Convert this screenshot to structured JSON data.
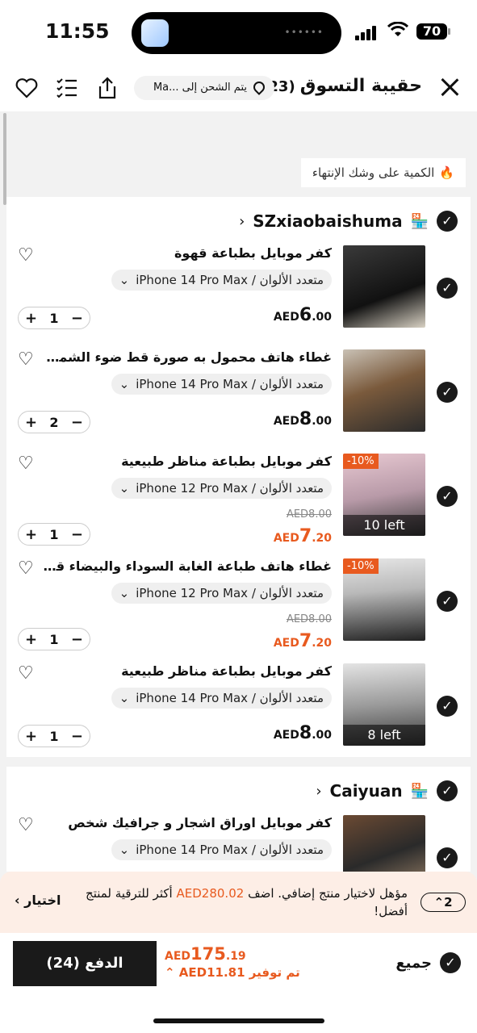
{
  "status_bar": {
    "time": "11:55",
    "battery": "70"
  },
  "header": {
    "title": "حقيبة التسوق",
    "count": "(23)",
    "ship_to": "يتم الشحن إلى ...Ma"
  },
  "notice": "الكمية على وشك الإنتهاء",
  "stores": [
    {
      "name": "SZxiaobaishuma",
      "items": [
        {
          "name": "كفر موبايل بطباعة قهوة",
          "variant": "متعدد الألوان / iPhone 14 Pro Max",
          "qty": "1",
          "currency": "AED",
          "price_int": "6",
          "price_dec": ".00"
        },
        {
          "name": "غطاء هاتف محمول به صورة قط ضوء الشمس وزه...",
          "variant": "متعدد الألوان / iPhone 14 Pro Max",
          "qty": "2",
          "currency": "AED",
          "price_int": "8",
          "price_dec": ".00"
        },
        {
          "name": "كفر موبايل بطباعة مناظر طبيعية",
          "variant": "متعدد الألوان / iPhone 12 Pro Max",
          "qty": "1",
          "currency": "AED",
          "price_int": "7",
          "price_dec": ".20",
          "old_price": "AED8.00",
          "discount": "-10%",
          "stock": "10 left"
        },
        {
          "name": "غطاء هاتف طباعة الغابة السوداء والبيضاء قطعة وا...",
          "variant": "متعدد الألوان / iPhone 12 Pro Max",
          "qty": "1",
          "currency": "AED",
          "price_int": "7",
          "price_dec": ".20",
          "old_price": "AED8.00",
          "discount": "-10%"
        },
        {
          "name": "كفر موبايل بطباعة مناظر طبيعية",
          "variant": "متعدد الألوان / iPhone 14 Pro Max",
          "qty": "1",
          "currency": "AED",
          "price_int": "8",
          "price_dec": ".00",
          "stock": "8 left"
        }
      ]
    },
    {
      "name": "Caiyuan",
      "items": [
        {
          "name": "كفر موبايل اوراق اشجار و جرافيك شخص",
          "variant": "متعدد الألوان / iPhone 14 Pro Max"
        }
      ]
    }
  ],
  "upsell": {
    "badge": "2",
    "text_before": "مؤهل لاختيار منتج إضافي. اضف",
    "amount": "AED280.02",
    "text_after": "أكثر للترقية لمنتج أفضل!",
    "action": "اختيار"
  },
  "bottom": {
    "select_all": "جميع",
    "total_currency": "AED",
    "total_int": "175",
    "total_dec": ".19",
    "saving_label": "تم توفير",
    "saving_amount": "AED11.81",
    "pay_label": "الدفع",
    "pay_count": "(24)"
  },
  "colors": {
    "accent": "#e85a1f",
    "dark": "#1a1a1a"
  }
}
